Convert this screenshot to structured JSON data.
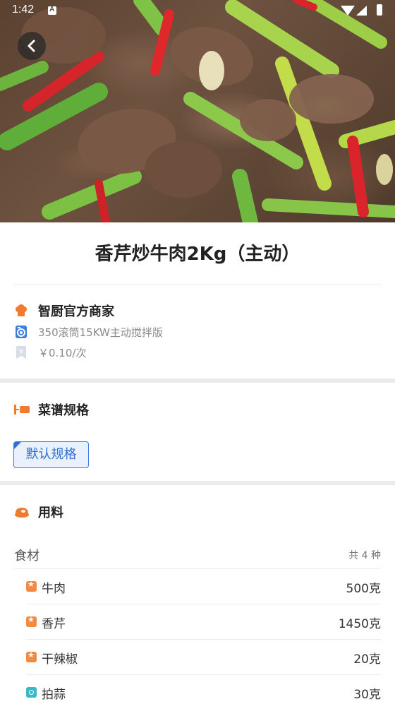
{
  "status_bar": {
    "time": "1:42"
  },
  "hero": {
    "alt": "香芹炒牛肉"
  },
  "recipe": {
    "title": "香芹炒牛肉2Kg（主动）"
  },
  "merchant": {
    "name": "智厨官方商家",
    "device": "350滚筒15KW主动搅拌版",
    "price": "￥0.10/次"
  },
  "spec_section": {
    "title": "菜谱规格",
    "selected": "默认规格"
  },
  "ingredients_section": {
    "title": "用料",
    "group_label": "食材",
    "count_label": "共 4 种",
    "items": [
      {
        "name": "牛肉",
        "qty": "500克",
        "icon": "star-icon"
      },
      {
        "name": "香芹",
        "qty": "1450克",
        "icon": "star-icon"
      },
      {
        "name": "干辣椒",
        "qty": "20克",
        "icon": "star-icon"
      },
      {
        "name": "拍蒜",
        "qty": "30克",
        "icon": "circle-icon"
      }
    ]
  },
  "colors": {
    "accent_blue": "#2f6fd0",
    "accent_orange": "#f08a45",
    "accent_teal": "#39b8c8"
  }
}
